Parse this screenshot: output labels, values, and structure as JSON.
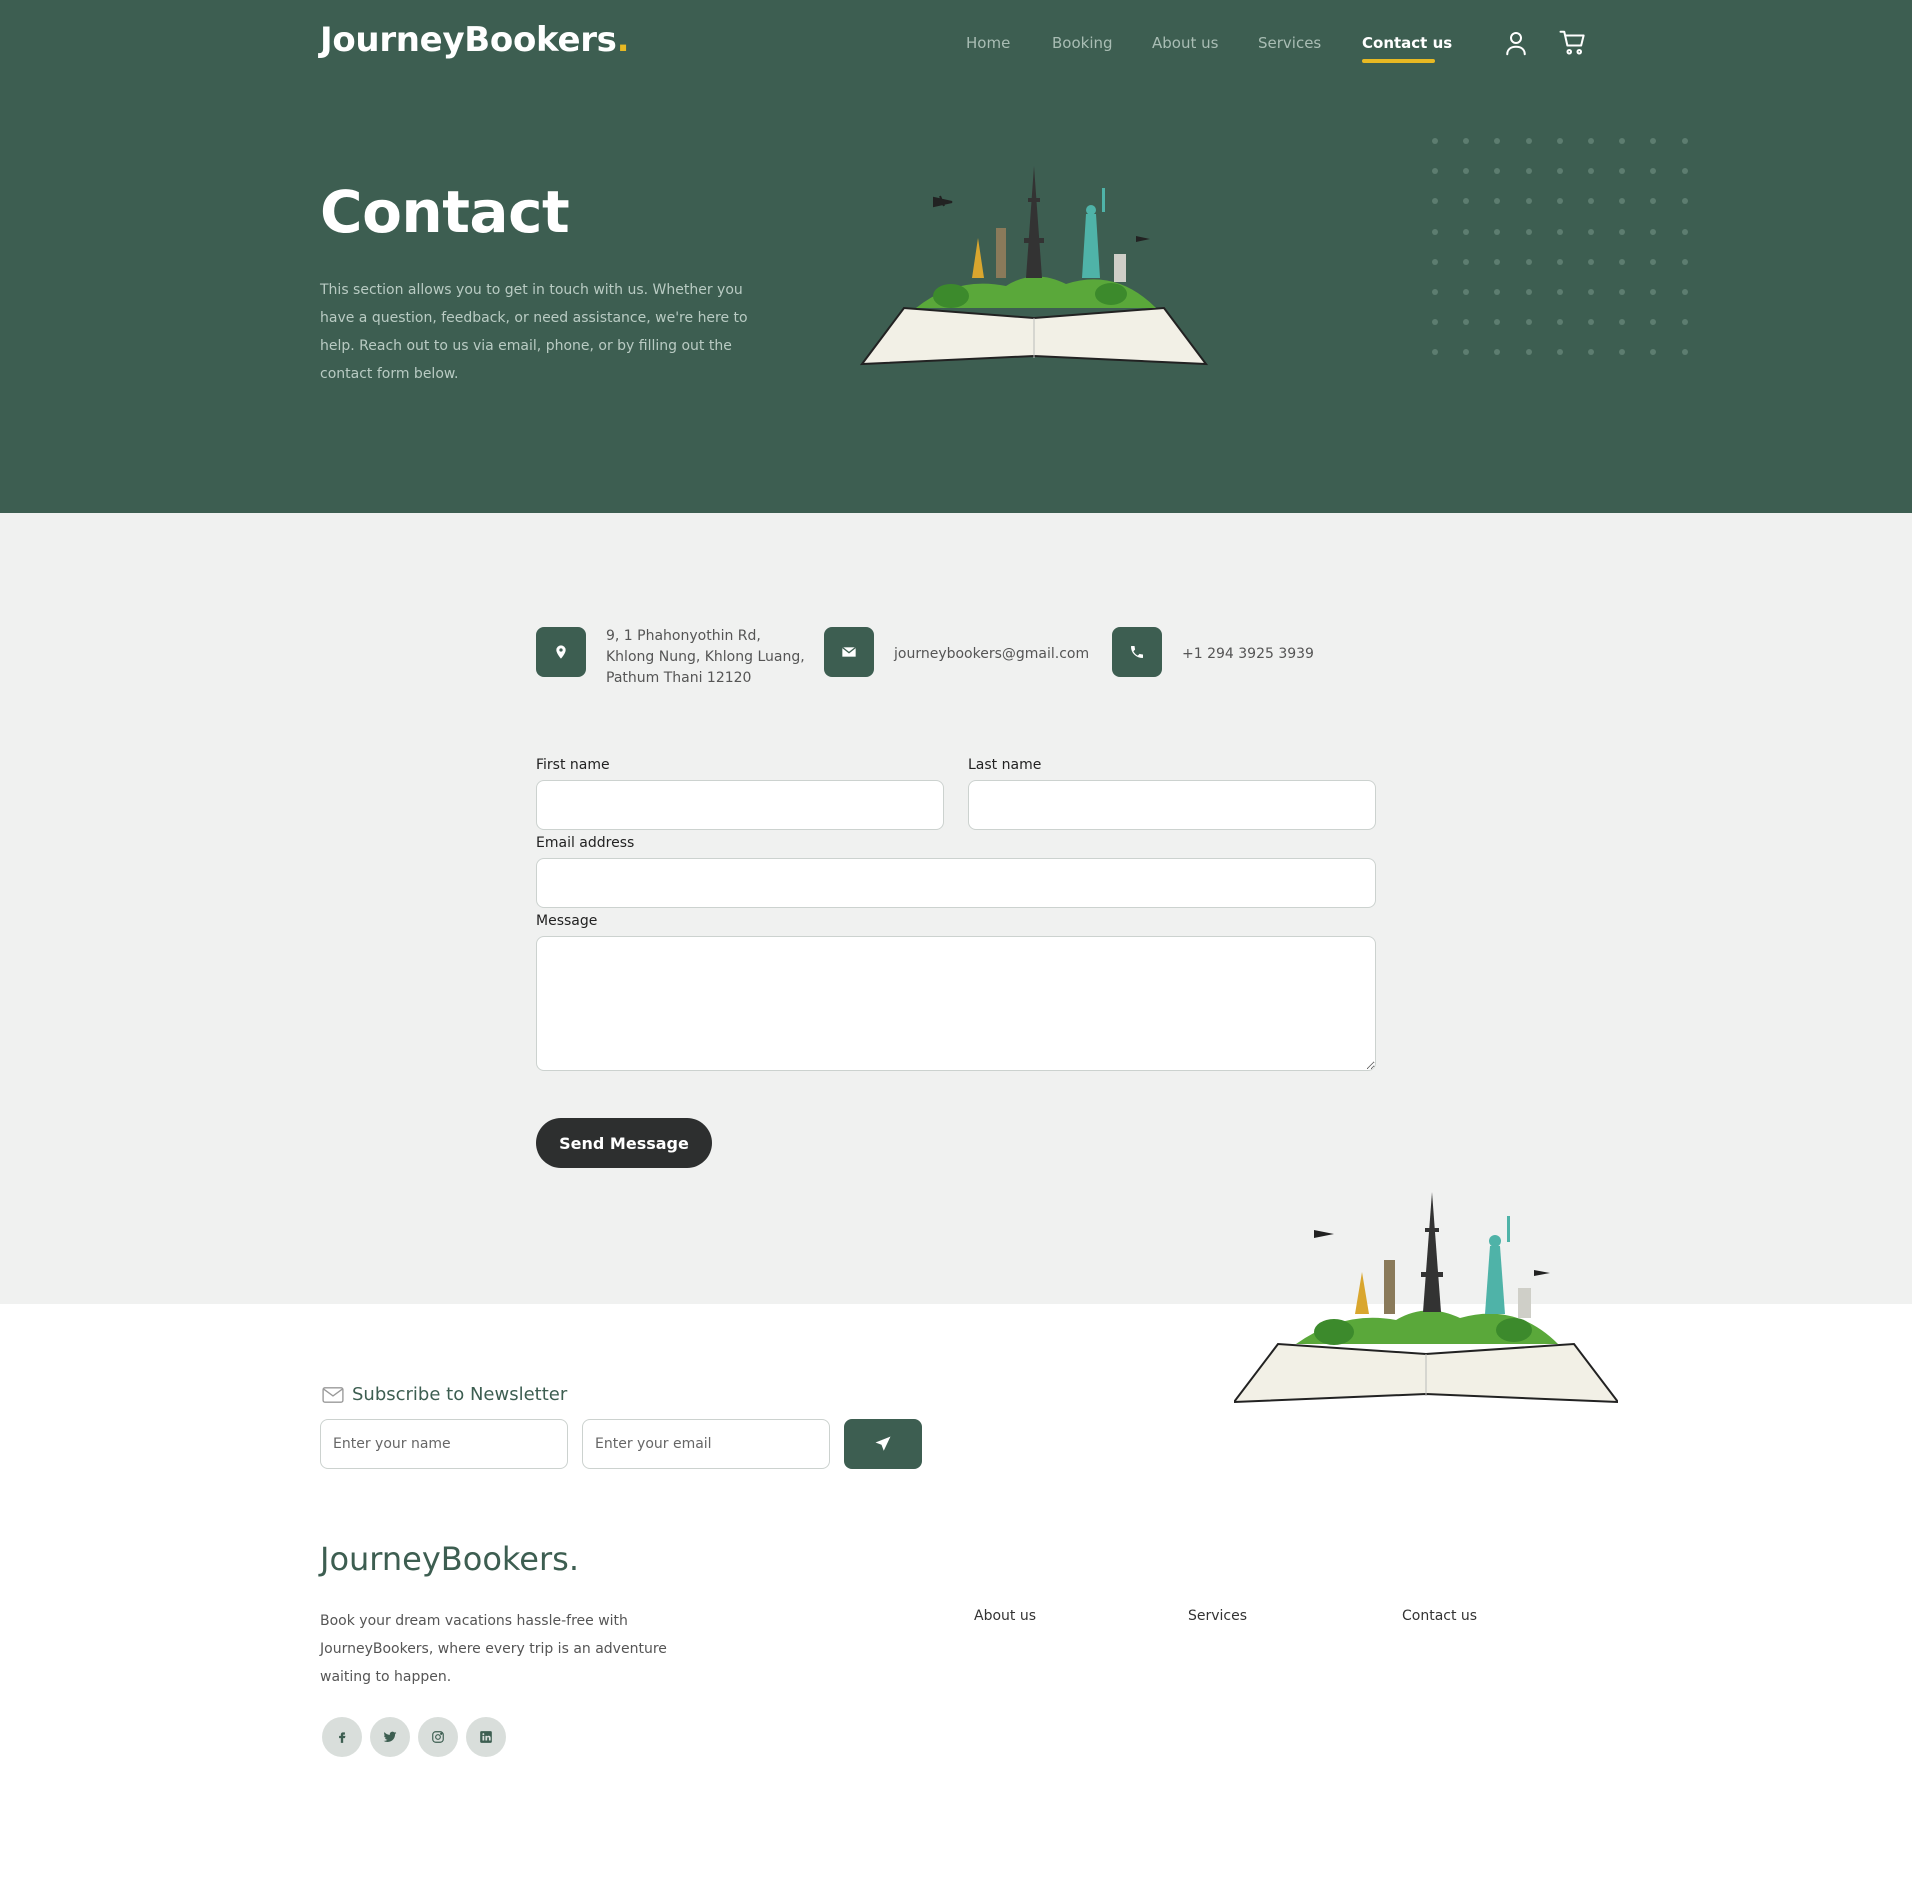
{
  "brand": {
    "name": "JourneyBookers",
    "dot": ".",
    "accent": "#e8b923",
    "primary": "#3d5e51"
  },
  "nav": {
    "items": [
      {
        "label": "Home"
      },
      {
        "label": "Booking"
      },
      {
        "label": "About us"
      },
      {
        "label": "Services"
      },
      {
        "label": "Contact us",
        "active": true
      }
    ],
    "icons": [
      "user-icon",
      "cart-icon"
    ]
  },
  "hero": {
    "title": "Contact",
    "description": "This section allows you to get in touch with us. Whether you have a question, feedback, or need assistance, we're here to help. Reach out to us via email, phone, or by filling out the contact form below."
  },
  "contact_info": {
    "address": "9, 1 Phahonyothin Rd, Khlong Nung, Khlong Luang, Pathum Thani 12120",
    "email": "journeybookers@gmail.com",
    "phone": "+1 294 3925 3939"
  },
  "form": {
    "first_name_label": "First name",
    "last_name_label": "Last name",
    "email_label": "Email address",
    "message_label": "Message",
    "first_name_value": "",
    "last_name_value": "",
    "email_value": "",
    "message_value": "",
    "submit_label": "Send Message"
  },
  "newsletter": {
    "title": "Subscribe to Newsletter",
    "name_placeholder": "Enter your name",
    "email_placeholder": "Enter your email"
  },
  "footer": {
    "logo": "JourneyBookers.",
    "description": "Book your dream vacations hassle-free with JourneyBookers, where every trip is an adventure waiting to happen.",
    "links": [
      {
        "label": "About us"
      },
      {
        "label": "Services"
      },
      {
        "label": "Contact us"
      }
    ],
    "social": [
      "facebook-icon",
      "twitter-icon",
      "instagram-icon",
      "linkedin-icon"
    ]
  }
}
